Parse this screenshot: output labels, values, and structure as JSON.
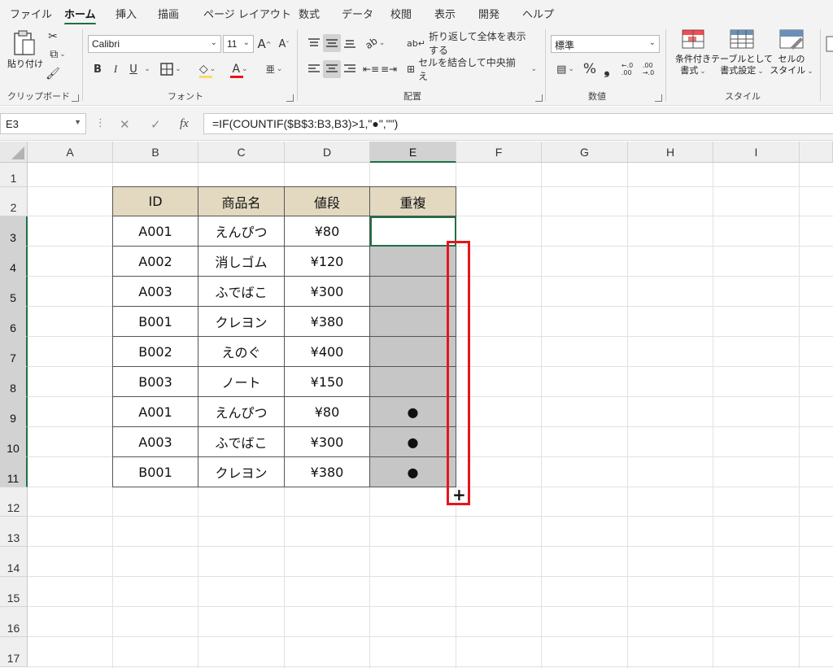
{
  "menu": {
    "tabs": [
      "ファイル",
      "ホーム",
      "挿入",
      "描画",
      "ページ レイアウト",
      "数式",
      "データ",
      "校閲",
      "表示",
      "開発",
      "ヘルプ"
    ],
    "active_tab": "ホーム"
  },
  "ribbon": {
    "clipboard": {
      "paste_label": "貼り付け",
      "group_label": "クリップボード"
    },
    "font": {
      "font_name": "Calibri",
      "font_size": "11",
      "grow_label": "A",
      "shrink_label": "A",
      "bold": "B",
      "italic": "I",
      "underline": "U",
      "font_color_glyph": "A",
      "phonetic_glyph": "亜",
      "group_label": "フォント"
    },
    "alignment": {
      "wrap_text": "折り返して全体を表示する",
      "merge_center": "セルを結合して中央揃え",
      "group_label": "配置"
    },
    "number": {
      "format": "標準",
      "percent": "%",
      "comma": "❟",
      "inc_decimal": "←.0\n.00",
      "dec_decimal": ".00\n→.0",
      "group_label": "数値"
    },
    "styles": {
      "conditional_line1": "条件付き",
      "conditional_line2": "書式",
      "table_line1": "テーブルとして",
      "table_line2": "書式設定",
      "cell_line1": "セルの",
      "cell_line2": "スタイル",
      "group_label": "スタイル"
    },
    "colors": {
      "accent": "#1e7145",
      "font_color_bar": "#e8141c",
      "highlight_bar": "#ffd966"
    }
  },
  "formula_bar": {
    "name_box": "E3",
    "cancel_icon": "✕",
    "enter_icon": "✓",
    "fx_label": "fx",
    "formula": "=IF(COUNTIF($B$3:B3,B3)>1,\"●\",\"\")"
  },
  "sheet": {
    "columns": [
      "A",
      "B",
      "C",
      "D",
      "E",
      "F",
      "G",
      "H",
      "I"
    ],
    "selected_column": "E",
    "rows": [
      "1",
      "2",
      "3",
      "4",
      "5",
      "6",
      "7",
      "8",
      "9",
      "10",
      "11",
      "12",
      "13",
      "14",
      "15",
      "16",
      "17"
    ],
    "selected_rows": [
      "3",
      "4",
      "5",
      "6",
      "7",
      "8",
      "9",
      "10",
      "11"
    ],
    "table": {
      "headers": [
        "ID",
        "商品名",
        "値段",
        "重複"
      ],
      "rows": [
        [
          "A001",
          "えんぴつ",
          "¥80",
          ""
        ],
        [
          "A002",
          "消しゴム",
          "¥120",
          ""
        ],
        [
          "A003",
          "ふでばこ",
          "¥300",
          ""
        ],
        [
          "B001",
          "クレヨン",
          "¥380",
          ""
        ],
        [
          "B002",
          "えのぐ",
          "¥400",
          ""
        ],
        [
          "B003",
          "ノート",
          "¥150",
          ""
        ],
        [
          "A001",
          "えんぴつ",
          "¥80",
          "●"
        ],
        [
          "A003",
          "ふでばこ",
          "¥300",
          "●"
        ],
        [
          "B001",
          "クレヨン",
          "¥380",
          "●"
        ]
      ]
    },
    "colors": {
      "header_fill": "#e2d9c0",
      "selection_fill": "#c6c6c6",
      "highlight_box": "#e8141c"
    },
    "fill_handle_icon": "+"
  }
}
